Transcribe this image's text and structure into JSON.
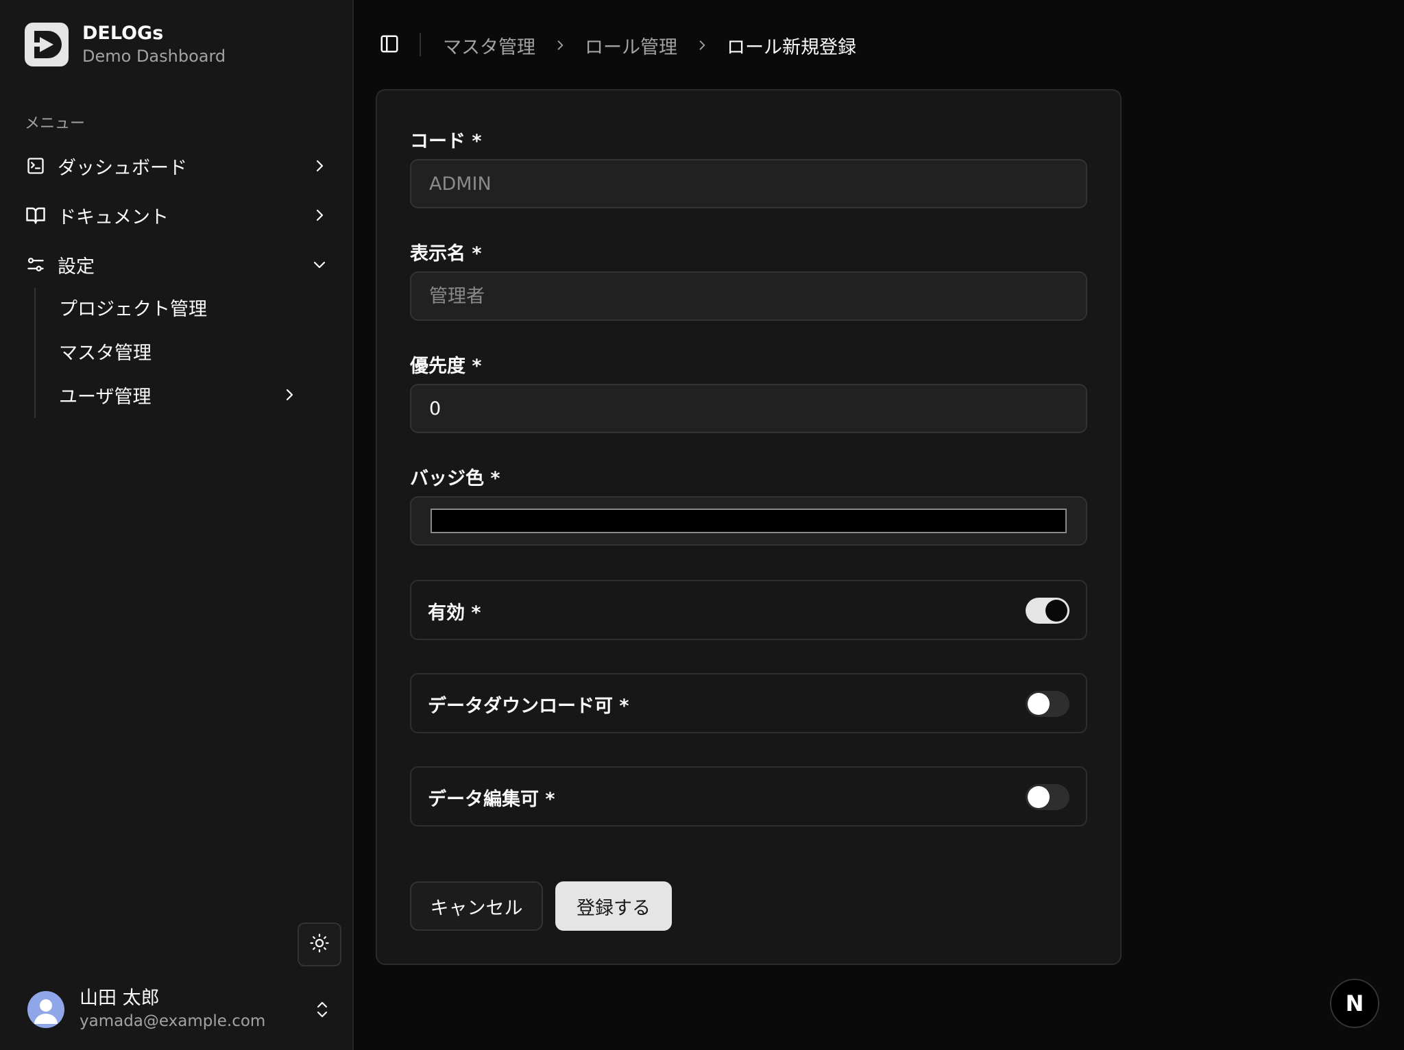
{
  "brand": {
    "name": "DELOGs",
    "subtitle": "Demo Dashboard"
  },
  "sidebar": {
    "menu_label": "メニュー",
    "items": [
      {
        "label": "ダッシュボード",
        "icon": "terminal-square-icon",
        "chevron": "chevron-right-icon"
      },
      {
        "label": "ドキュメント",
        "icon": "book-open-icon",
        "chevron": "chevron-right-icon"
      },
      {
        "label": "設定",
        "icon": "settings-sliders-icon",
        "chevron": "chevron-down-icon"
      }
    ],
    "sub_items": [
      {
        "label": "プロジェクト管理"
      },
      {
        "label": "マスタ管理"
      },
      {
        "label": "ユーザ管理",
        "chevron": "chevron-right-icon"
      }
    ]
  },
  "user": {
    "name": "山田 太郎",
    "email": "yamada@example.com"
  },
  "breadcrumb": [
    "マスタ管理",
    "ロール管理",
    "ロール新規登録"
  ],
  "form": {
    "code": {
      "label": "コード *",
      "placeholder": "ADMIN",
      "value": ""
    },
    "display_name": {
      "label": "表示名 *",
      "placeholder": "管理者",
      "value": ""
    },
    "priority": {
      "label": "優先度 *",
      "value": "0"
    },
    "badge_color": {
      "label": "バッジ色 *",
      "value": "#000000"
    },
    "switches": [
      {
        "label": "有効 *",
        "checked": true
      },
      {
        "label": "データダウンロード可 *",
        "checked": false
      },
      {
        "label": "データ編集可 *",
        "checked": false
      }
    ],
    "cancel_label": "キャンセル",
    "submit_label": "登録する"
  },
  "next_badge": "N",
  "colors": {
    "background": "#0a0a0a",
    "sidebar": "#171717",
    "card": "#171717",
    "primary": "#e5e5e5"
  }
}
